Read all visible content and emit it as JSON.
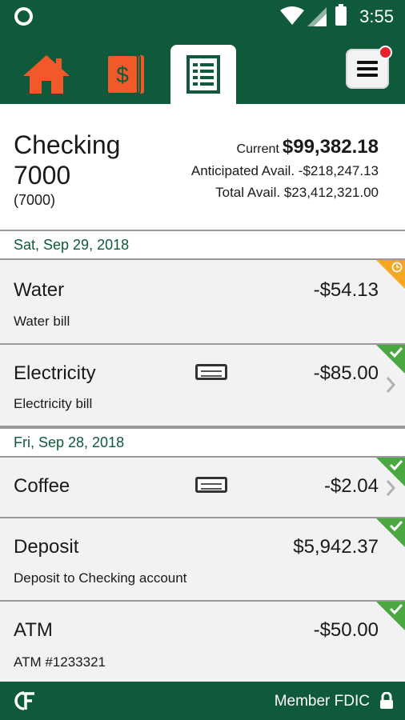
{
  "status_bar": {
    "time": "3:55"
  },
  "nav": {
    "tabs": [
      {
        "name": "home",
        "icon": "home-icon"
      },
      {
        "name": "pay",
        "icon": "dollar-bill-icon"
      },
      {
        "name": "register",
        "icon": "register-list-icon",
        "active": true
      }
    ],
    "menu_icon": "hamburger-menu-icon",
    "notification": true
  },
  "account": {
    "name": "Checking 7000",
    "number": "(7000)",
    "current_label": "Current",
    "current_amount": "$99,382.18",
    "anticipated_label": "Anticipated Avail.",
    "anticipated_amount": "-$218,247.13",
    "total_label": "Total Avail.",
    "total_amount": "$23,412,321.00"
  },
  "groups": [
    {
      "date": "Sat, Sep 29, 2018",
      "transactions": [
        {
          "title": "Water",
          "description": "Water bill",
          "amount": "-$54.13",
          "status": "pending",
          "status_icon": "clock-icon"
        },
        {
          "title": "Electricity",
          "description": "Electricity bill",
          "amount": "-$85.00",
          "status": "cleared",
          "status_icon": "check-icon",
          "card_icon": "credit-card-icon",
          "chevron": true
        }
      ]
    },
    {
      "date": "Fri, Sep 28, 2018",
      "transactions": [
        {
          "title": "Coffee",
          "description": "",
          "amount": "-$2.04",
          "status": "cleared",
          "status_icon": "check-icon",
          "card_icon": "credit-card-icon",
          "chevron": true
        },
        {
          "title": "Deposit",
          "description": "Deposit to Checking account",
          "amount": "$5,942.37",
          "status": "cleared",
          "status_icon": "check-icon"
        },
        {
          "title": "ATM",
          "description": "ATM #1233321",
          "amount": "-$50.00",
          "status": "cleared",
          "status_icon": "check-icon"
        }
      ]
    }
  ],
  "footer": {
    "text": "Member FDIC",
    "logo_icon": "cf-logo-icon",
    "lock_icon": "lock-icon"
  },
  "colors": {
    "brand_green": "#0e5a3a",
    "accent_orange": "#f2592a",
    "cleared_green": "#49a83f",
    "pending_orange": "#f5a623",
    "notification_red": "#e8232e"
  }
}
